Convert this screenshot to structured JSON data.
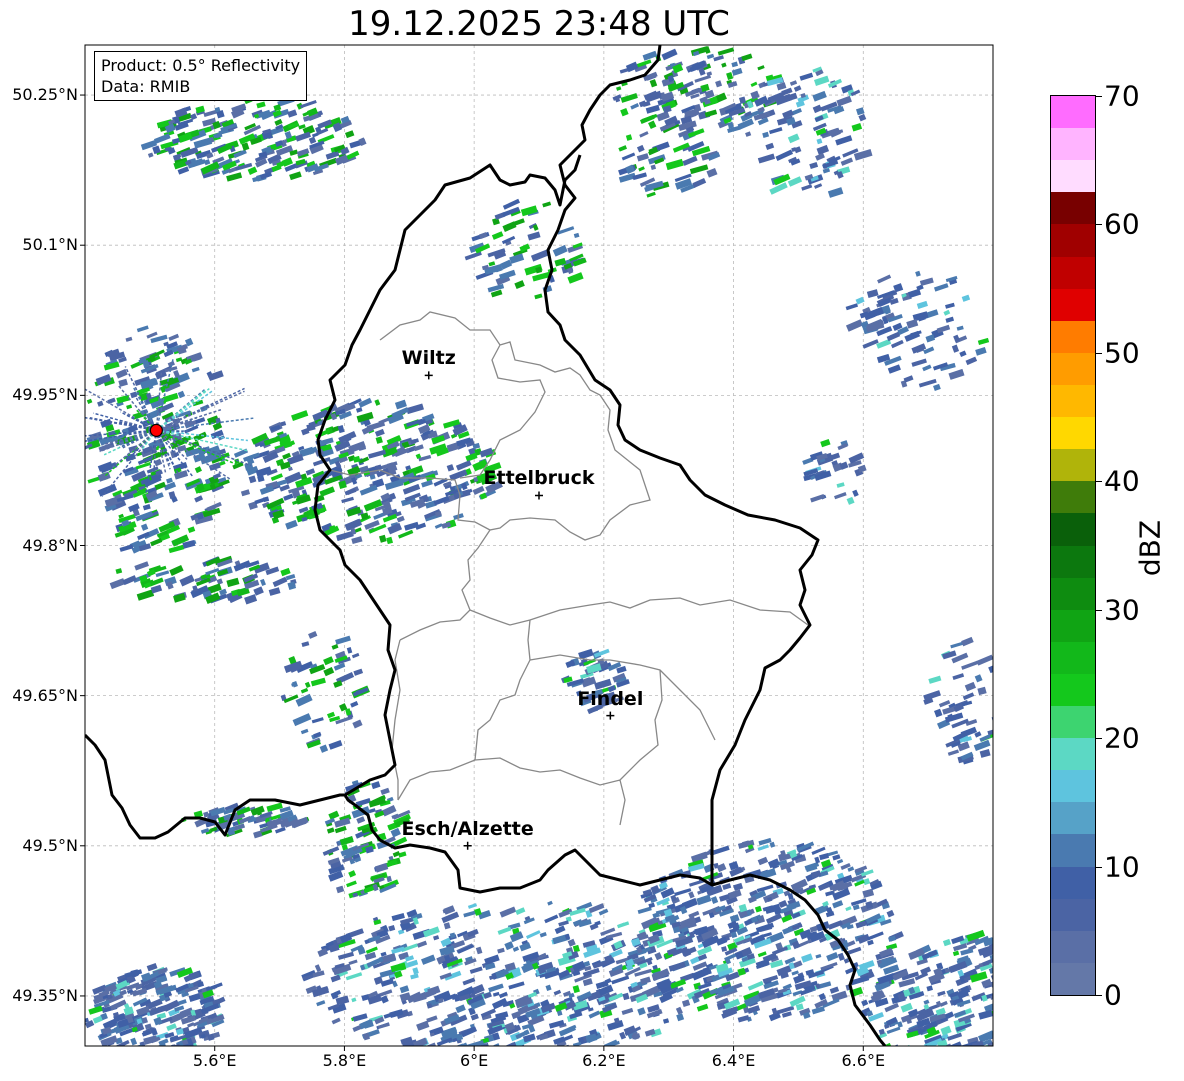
{
  "title": "19.12.2025 23:48 UTC",
  "info": {
    "product": "Product: 0.5° Reflectivity",
    "data": "Data: RMIB"
  },
  "axes": {
    "lat_ticks": [
      "50.25°N",
      "50.1°N",
      "49.95°N",
      "49.8°N",
      "49.65°N",
      "49.5°N",
      "49.35°N"
    ],
    "lon_ticks": [
      "5.6°E",
      "5.8°E",
      "6°E",
      "6.2°E",
      "6.4°E",
      "6.6°E"
    ]
  },
  "cities": [
    {
      "name": "Wiltz",
      "lon": 5.93,
      "lat": 49.97
    },
    {
      "name": "Ettelbruck",
      "lon": 6.1,
      "lat": 49.85
    },
    {
      "name": "Findel",
      "lon": 6.21,
      "lat": 49.63
    },
    {
      "name": "Esch/Alzette",
      "lon": 5.99,
      "lat": 49.5
    }
  ],
  "radar_site": {
    "lon": 5.51,
    "lat": 49.915,
    "color": "#ff0000"
  },
  "colorbar": {
    "label": "dBZ",
    "min": 0,
    "max": 70,
    "step": 2.5,
    "ticks": [
      "0",
      "10",
      "20",
      "30",
      "40",
      "50",
      "60",
      "70"
    ],
    "colors": [
      "#6478a8",
      "#5a6fa6",
      "#4b64a4",
      "#4060a6",
      "#4a7ab0",
      "#56a2c8",
      "#5ec4de",
      "#5cd8c4",
      "#3dd470",
      "#14c81c",
      "#12b81a",
      "#10a414",
      "#0e8c10",
      "#0c780e",
      "#0a600a",
      "#3f7c0a",
      "#b0b40a",
      "#ffd800",
      "#ffb800",
      "#ff9c00",
      "#ff7c00",
      "#e00000",
      "#c00000",
      "#a00000",
      "#780000",
      "#ffdcff",
      "#ffb4ff",
      "#ff6cff",
      "#e83cf0"
    ]
  },
  "map": {
    "lon_min": 5.4,
    "lon_max": 6.8,
    "lat_min": 49.3,
    "lat_max": 50.3,
    "gridlines": true
  }
}
